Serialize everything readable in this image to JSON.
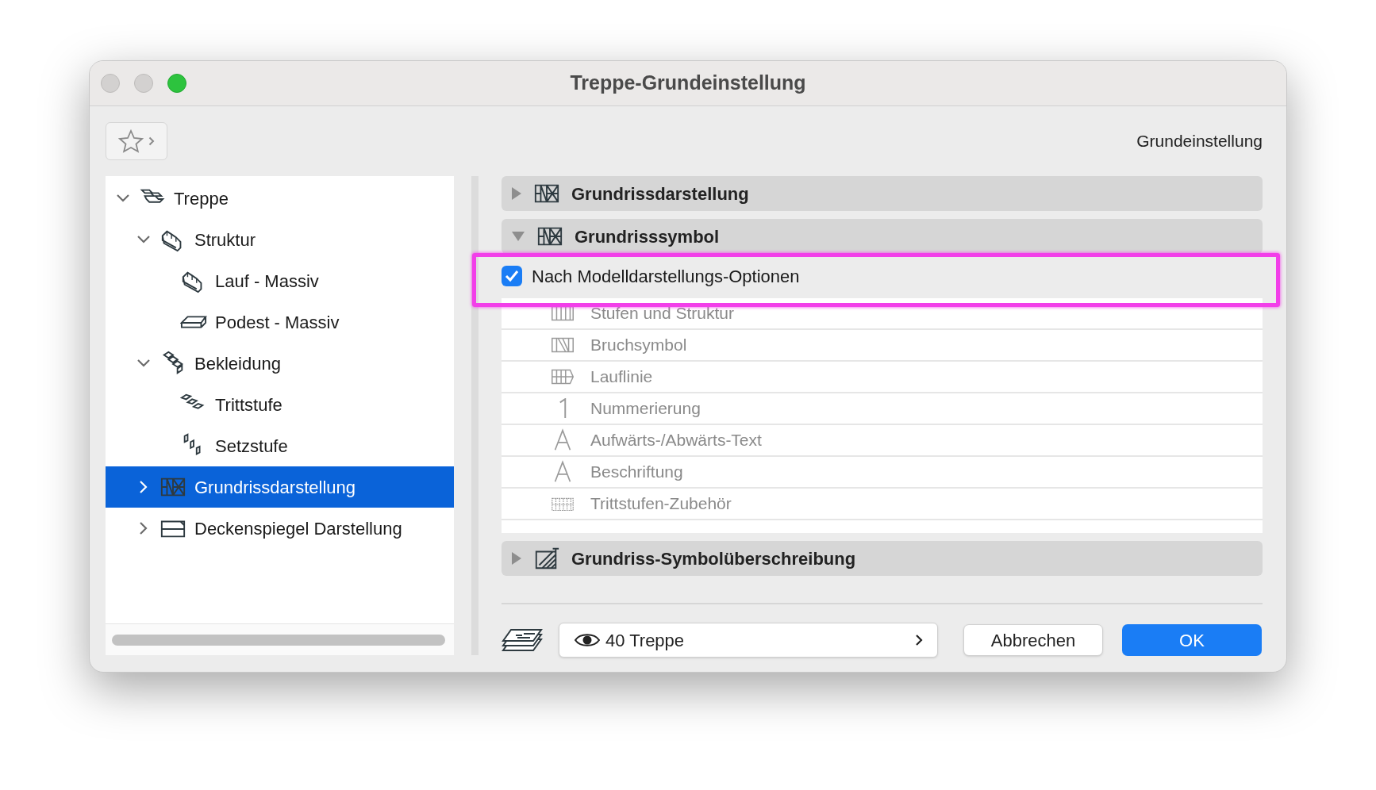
{
  "window": {
    "title": "Treppe-Grundeinstellung"
  },
  "toolbar": {
    "preset_label": "Grundeinstellung"
  },
  "tree": {
    "items": [
      {
        "label": "Treppe",
        "kind": "stair",
        "expanded": true,
        "selected": false,
        "children": [
          {
            "label": "Struktur",
            "kind": "structure",
            "expanded": true,
            "selected": false,
            "children": [
              {
                "label": "Lauf - Massiv",
                "kind": "structure",
                "selected": false
              },
              {
                "label": "Podest - Massiv",
                "kind": "landing",
                "selected": false
              }
            ]
          },
          {
            "label": "Bekleidung",
            "kind": "cladding",
            "expanded": true,
            "selected": false,
            "children": [
              {
                "label": "Trittstufe",
                "kind": "tread",
                "selected": false
              },
              {
                "label": "Setzstufe",
                "kind": "riser",
                "selected": false
              }
            ]
          },
          {
            "label": "Grundrissdarstellung",
            "kind": "floorplan",
            "expanded": false,
            "selected": true
          },
          {
            "label": "Deckenspiegel Darstellung",
            "kind": "ceiling",
            "expanded": false,
            "selected": false
          }
        ]
      }
    ]
  },
  "panels": [
    {
      "title": "Grundrissdarstellung",
      "kind": "floorplan",
      "expanded": false
    },
    {
      "title": "Grundrisssymbol",
      "kind": "floorplan",
      "expanded": true,
      "checkbox": {
        "label": "Nach Modelldarstellungs-Optionen",
        "checked": true
      },
      "rows": [
        {
          "label": "Stufen und Struktur",
          "kind": "steps",
          "disabled": true
        },
        {
          "label": "Bruchsymbol",
          "kind": "break",
          "disabled": true
        },
        {
          "label": "Lauflinie",
          "kind": "walkline",
          "disabled": true
        },
        {
          "label": "Nummerierung",
          "kind": "number",
          "disabled": true
        },
        {
          "label": "Aufwärts-/Abwärts-Text",
          "kind": "text",
          "disabled": true
        },
        {
          "label": "Beschriftung",
          "kind": "text",
          "disabled": true
        },
        {
          "label": "Trittstufen-Zubehör",
          "kind": "grid",
          "disabled": true
        }
      ]
    },
    {
      "title": "Grundriss-Symbolüberschreibung",
      "kind": "override",
      "expanded": false
    }
  ],
  "footer": {
    "layer": "40 Treppe",
    "buttons": [
      {
        "label": "Abbrechen",
        "primary": false
      },
      {
        "label": "OK",
        "primary": true
      }
    ]
  }
}
